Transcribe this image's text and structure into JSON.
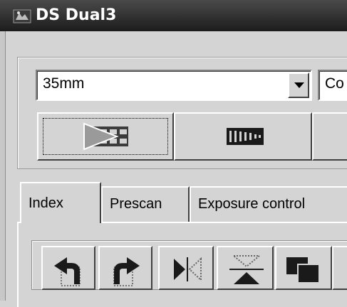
{
  "window": {
    "title": "DS Dual3",
    "icon": "scanner-app-icon"
  },
  "film_type": {
    "selected": "35mm",
    "icon": "chevron-down-icon"
  },
  "second_combo": {
    "selected": "Co"
  },
  "toolbar": {
    "buttons": [
      {
        "name": "scan-button",
        "icon": "scan-frames-icon"
      },
      {
        "name": "eject-button",
        "icon": "film-strip-icon"
      }
    ]
  },
  "tabs": [
    {
      "label": "Index",
      "active": true
    },
    {
      "label": "Prescan",
      "active": false
    },
    {
      "label": "Exposure control",
      "active": false
    }
  ],
  "tools": [
    {
      "name": "rotate-left-button",
      "icon": "rotate-left-icon"
    },
    {
      "name": "rotate-right-button",
      "icon": "rotate-right-icon"
    },
    {
      "name": "flip-horizontal-button",
      "icon": "flip-horizontal-icon"
    },
    {
      "name": "flip-vertical-button",
      "icon": "flip-vertical-icon"
    },
    {
      "name": "invert-button",
      "icon": "invert-icon"
    }
  ]
}
